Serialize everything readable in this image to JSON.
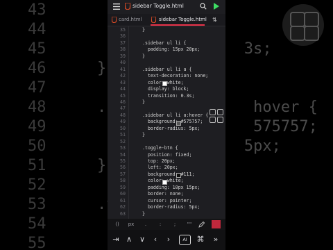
{
  "editor_title": "sidebar Toggle.html",
  "tabs": [
    {
      "label": "card.html",
      "active": false
    },
    {
      "label": "sidebar Toggle.html",
      "active": true
    }
  ],
  "colors": {
    "accent_run": "#3ddc63",
    "html_icon": "#e44d26",
    "active_tab_underline": "#e8334a",
    "swatch_white": "#ffffff",
    "swatch_575757": "#575757",
    "swatch_111": "#111111"
  },
  "icons": {
    "menu": "menu-icon",
    "html_file": "html-file-icon",
    "search": "search-icon",
    "run": "play-icon",
    "more": "more-vertical-icon",
    "sort": "sort-icon",
    "grid": "grid-icon"
  },
  "code_lines": [
    {
      "n": "35",
      "t": "}"
    },
    {
      "n": "36",
      "t": ""
    },
    {
      "n": "37",
      "t": ".sidebar ul li {"
    },
    {
      "n": "38",
      "t": "  padding: 15px 20px;"
    },
    {
      "n": "39",
      "t": "}"
    },
    {
      "n": "40",
      "t": ""
    },
    {
      "n": "41",
      "t": ".sidebar ul li a {"
    },
    {
      "n": "42",
      "t": "  text-decoration: none;"
    },
    {
      "n": "43",
      "t": "  color: white;",
      "swatch": "#ffffff"
    },
    {
      "n": "44",
      "t": "  display: block;"
    },
    {
      "n": "45",
      "t": "  transition: 0.3s;"
    },
    {
      "n": "46",
      "t": "}"
    },
    {
      "n": "47",
      "t": ""
    },
    {
      "n": "48",
      "t": ".sidebar ul li a:hover {"
    },
    {
      "n": "49",
      "t": "  background: #575757;",
      "swatch": "#575757"
    },
    {
      "n": "50",
      "t": "  border-radius: 5px;"
    },
    {
      "n": "51",
      "t": "}"
    },
    {
      "n": "52",
      "t": ""
    },
    {
      "n": "53",
      "t": ".toggle-btn {"
    },
    {
      "n": "54",
      "t": "  position: fixed;"
    },
    {
      "n": "55",
      "t": "  top: 20px;"
    },
    {
      "n": "56",
      "t": "  left: 20px;"
    },
    {
      "n": "57",
      "t": "  background: #111;",
      "swatch": "#111111"
    },
    {
      "n": "58",
      "t": "  color: white;",
      "swatch": "#ffffff"
    },
    {
      "n": "59",
      "t": "  padding: 10px 15px;"
    },
    {
      "n": "60",
      "t": "  border: none;"
    },
    {
      "n": "61",
      "t": "  cursor: pointer;"
    },
    {
      "n": "62",
      "t": "  border-radius: 5px;"
    },
    {
      "n": "63",
      "t": "}"
    }
  ],
  "background_code": [
    {
      "n": "43",
      "t": ""
    },
    {
      "n": "44",
      "t": ""
    },
    {
      "n": "45",
      "t": "                3s;"
    },
    {
      "n": "46",
      "t": "}"
    },
    {
      "n": "47",
      "t": ""
    },
    {
      "n": "48",
      "t": ".s               hover {"
    },
    {
      "n": "49",
      "t": "                 575757;"
    },
    {
      "n": "50",
      "t": "                5px;"
    },
    {
      "n": "51",
      "t": "}"
    },
    {
      "n": "52",
      "t": ""
    },
    {
      "n": "53",
      "t": ".t"
    },
    {
      "n": "54",
      "t": ""
    },
    {
      "n": "55",
      "t": ""
    }
  ],
  "accessory_keys": [
    "()",
    "px",
    ".",
    ":",
    ";",
    "\"\"",
    "pen-icon"
  ],
  "nav_keys": [
    "tab-icon",
    "up-icon",
    "down-icon",
    "left-icon",
    "right-icon",
    "AI",
    "command-icon",
    "forward-icon"
  ]
}
